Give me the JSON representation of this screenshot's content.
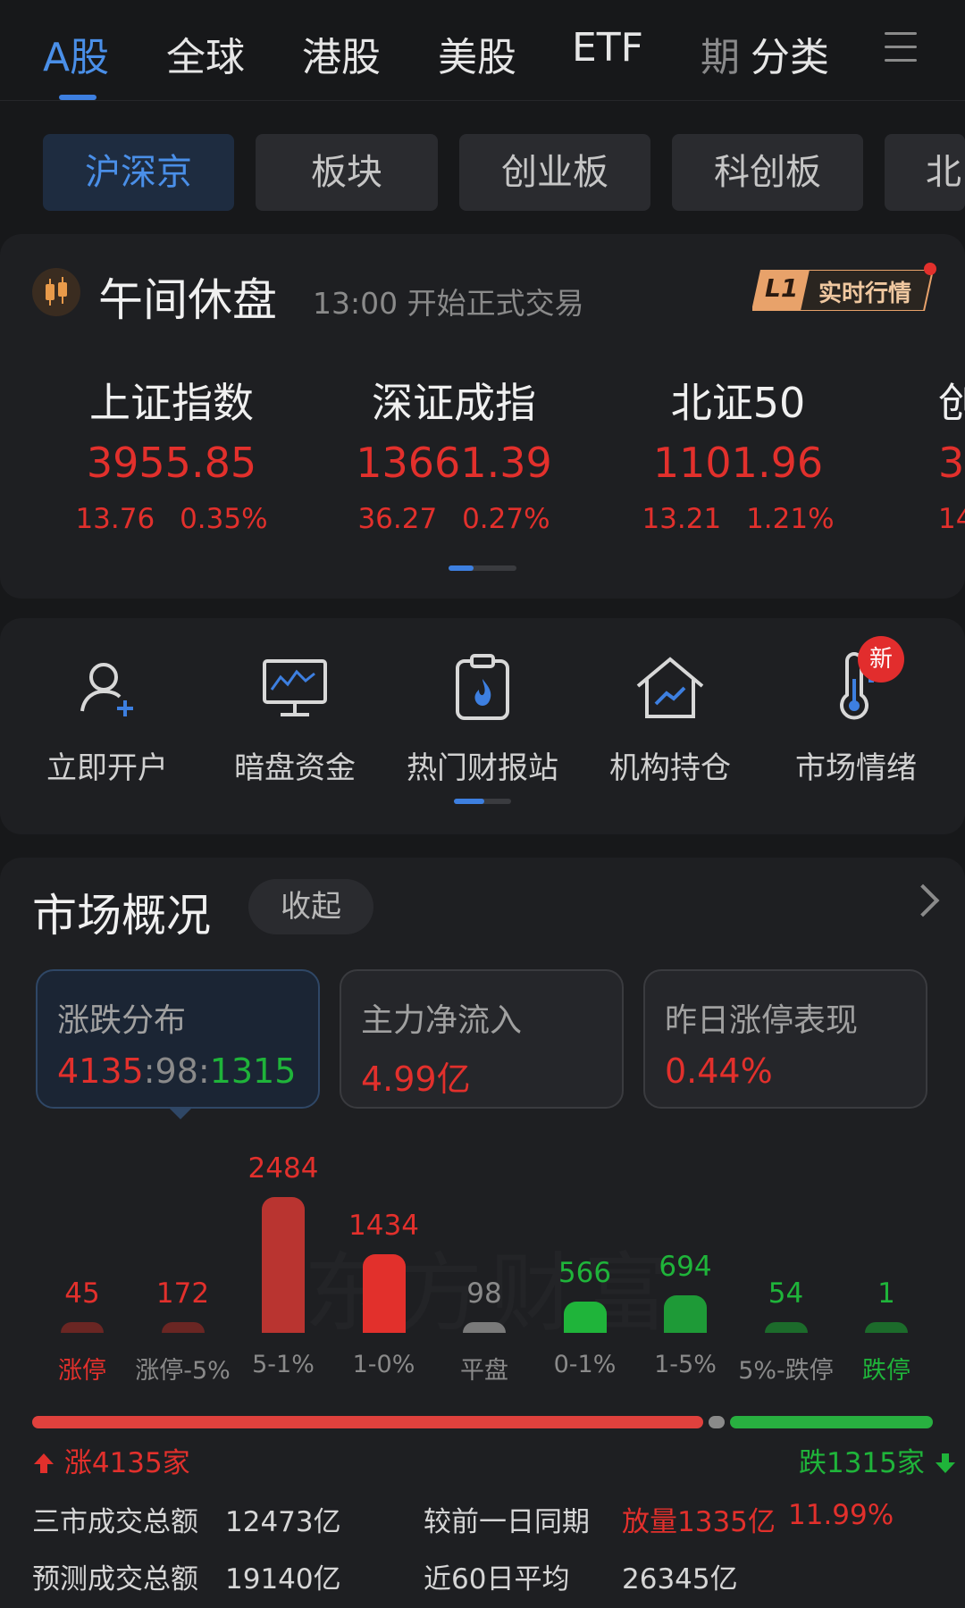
{
  "top_tabs": [
    "A股",
    "全球",
    "港股",
    "美股",
    "ETF",
    "期",
    "分类"
  ],
  "sub_tabs": [
    "沪深京",
    "板块",
    "创业板",
    "科创板",
    "北"
  ],
  "status": {
    "title": "午间休盘",
    "subtitle": "13:00 开始正式交易",
    "badge_l1": "L1",
    "badge_text": "实时行情"
  },
  "indices": [
    {
      "name": "上证指数",
      "value": "3955.85",
      "change": "13.76",
      "percent": "0.35%"
    },
    {
      "name": "深证成指",
      "value": "13661.39",
      "change": "36.27",
      "percent": "0.27%"
    },
    {
      "name": "北证50",
      "value": "1101.96",
      "change": "13.21",
      "percent": "1.21%"
    },
    {
      "name": "创",
      "value": "3",
      "change": "14.",
      "percent": ""
    }
  ],
  "shortcuts": [
    {
      "label": "立即开户",
      "icon": "add-user-icon"
    },
    {
      "label": "暗盘资金",
      "icon": "monitor-chart-icon"
    },
    {
      "label": "热门财报站",
      "icon": "clipboard-fire-icon"
    },
    {
      "label": "机构持仓",
      "icon": "house-trend-icon"
    },
    {
      "label": "市场情绪",
      "icon": "thermometer-icon"
    }
  ],
  "new_badge": "新",
  "overview": {
    "title": "市场概况",
    "collapse_label": "收起",
    "metrics": [
      {
        "label": "涨跌分布",
        "up": "4135",
        "flat": "98",
        "down": "1315"
      },
      {
        "label": "主力净流入",
        "value": "4.99亿"
      },
      {
        "label": "昨日涨停表现",
        "value": "0.44%"
      }
    ]
  },
  "watermark": "东方财富",
  "chart_data": {
    "type": "bar",
    "categories": [
      "涨停",
      "涨停-5%",
      "5-1%",
      "1-0%",
      "平盘",
      "0-1%",
      "1-5%",
      "5%-跌停",
      "跌停"
    ],
    "values": [
      45,
      172,
      2484,
      1434,
      98,
      566,
      694,
      54,
      1
    ],
    "colors": [
      "#6a2623",
      "#6a2623",
      "#b93430",
      "#e2302c",
      "#7a7a7a",
      "#1fb43a",
      "#1e9a37",
      "#1c6b2b",
      "#1c6b2b"
    ],
    "label_colors": [
      "#e2302c",
      "#e2302c",
      "#e2302c",
      "#e2302c",
      "#8a8a8a",
      "#1fb43a",
      "#1fb43a",
      "#1fb43a",
      "#1fb43a"
    ],
    "category_colors": [
      "#e2302c",
      "#8a8a8a",
      "#8a8a8a",
      "#8a8a8a",
      "#8a8a8a",
      "#8a8a8a",
      "#8a8a8a",
      "#8a8a8a",
      "#1fb43a"
    ]
  },
  "ratio": {
    "up_label": "涨4135家",
    "down_label": "跌1315家",
    "up": 4135,
    "flat": 98,
    "down": 1315
  },
  "stats": {
    "total_label": "三市成交总额",
    "total_value": "12473亿",
    "compare_label": "较前一日同期",
    "compare_value": "放量1335亿",
    "compare_pct": "11.99%",
    "forecast_label": "预测成交总额",
    "forecast_value": "19140亿",
    "avg_label": "近60日平均",
    "avg_value": "26345亿"
  },
  "colors": {
    "up": "#e2302c",
    "down": "#1fb43a",
    "accent": "#4a8fe8",
    "background": "#17181a"
  }
}
